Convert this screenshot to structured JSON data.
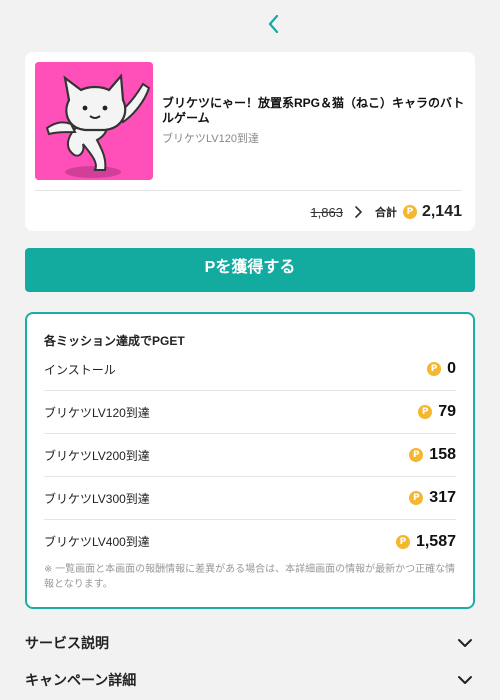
{
  "header": {
    "back_icon": "chevron-left-icon"
  },
  "app": {
    "title": "ブリケツにゃー！放置系RPG＆猫（ねこ）キャラのバトルゲーム",
    "subtitle": "ブリケツLV120到達",
    "thumbnail_bg": "#ff4fb8",
    "old_price": "1,863",
    "total_label": "合計",
    "total_value": "2,141"
  },
  "cta": {
    "label": "Pを獲得する",
    "color": "#13aaa0"
  },
  "missions": {
    "title": "各ミッション達成でPGET",
    "items": [
      {
        "label": "インストール",
        "value": "0"
      },
      {
        "label": "ブリケツLV120到達",
        "value": "79"
      },
      {
        "label": "ブリケツLV200到達",
        "value": "158"
      },
      {
        "label": "ブリケツLV300到達",
        "value": "317"
      },
      {
        "label": "ブリケツLV400到達",
        "value": "1,587"
      }
    ],
    "note": "※ 一覧画面と本画面の報酬情報に差異がある場合は、本詳細画面の情報が最新かつ正確な情報となります。"
  },
  "coin_glyph": "P",
  "coin_color": "#f5b630",
  "accordions": [
    {
      "label": "サービス説明"
    },
    {
      "label": "キャンペーン詳細"
    }
  ]
}
